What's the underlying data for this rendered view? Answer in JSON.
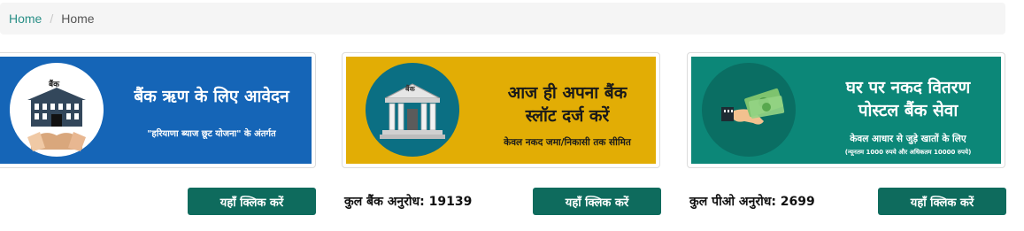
{
  "breadcrumb": {
    "home_link": "Home",
    "separator": "/",
    "current": "Home"
  },
  "cards": [
    {
      "title": "बैंक ऋण के लिए आवेदन",
      "subtitle": "\"हरियाणा ब्याज छूट योजना\" के अंतर्गत",
      "icon_label": "बैंक",
      "count_label": "",
      "button_label": "यहाँ क्लिक करें",
      "colors": {
        "bg": "#1565b7",
        "circle": "#ffffff",
        "text": "#ffffff"
      }
    },
    {
      "title_line1": "आज ही अपना बैंक",
      "title_line2": "स्लॉट दर्ज करें",
      "subtitle": "केवल नकद जमा/निकासी तक सीमित",
      "icon_label": "बैंक",
      "count_label": "कुल बैंक अनुरोध: 19139",
      "button_label": "यहाँ क्लिक करें",
      "colors": {
        "bg": "#e2ad05",
        "circle": "#0b6f83",
        "text": "#1a1a1a"
      }
    },
    {
      "title_line1": "घर पर नकद वितरण",
      "title_line2": "पोस्टल बैंक सेवा",
      "subtitle": "केवल आधार से जुड़े खातों के लिए",
      "note": "(न्यूनतम 1000 रुपये और अधिकतम 10000 रुपये)",
      "count_label": "कुल पीओ अनुरोध: 2699",
      "button_label": "यहाँ क्लिक करें",
      "colors": {
        "bg": "#0c8778",
        "circle": "#0a6e63",
        "text": "#ffffff"
      }
    }
  ]
}
